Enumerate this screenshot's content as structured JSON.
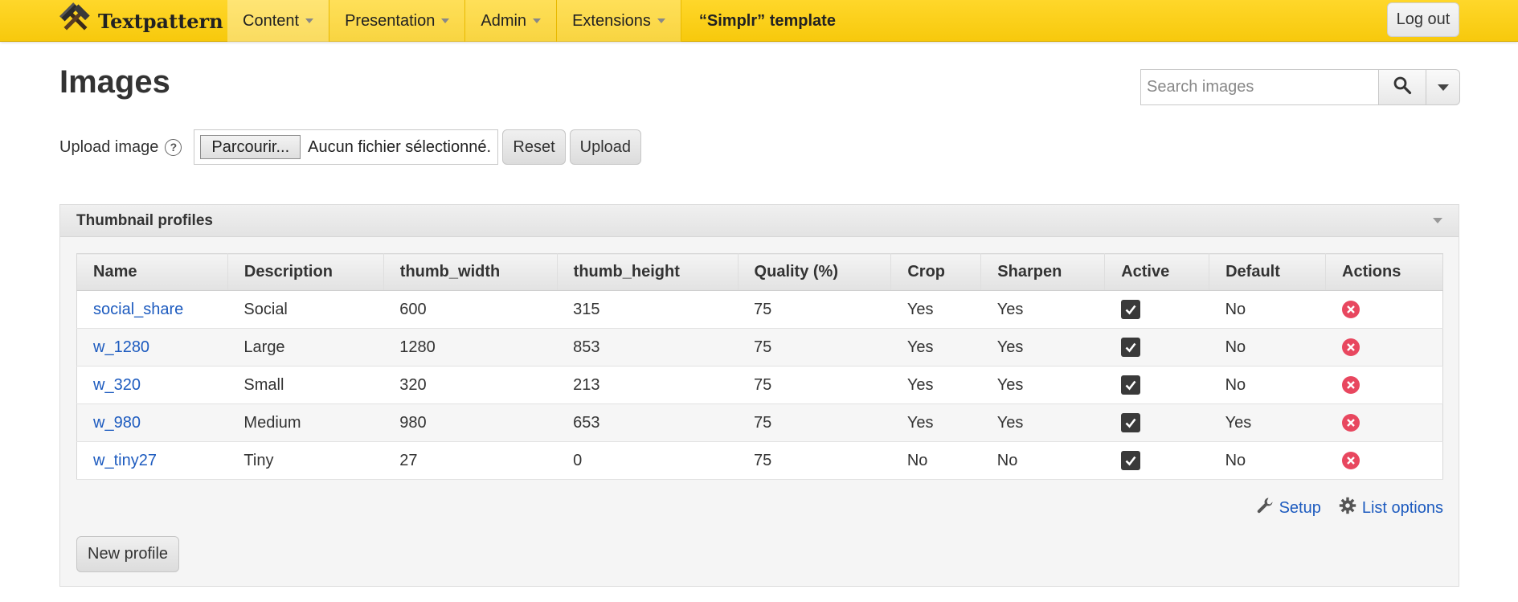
{
  "app": {
    "brand": "Textpattern",
    "site_name": "“Simplr” template",
    "logout_label": "Log out"
  },
  "nav": [
    {
      "label": "Content",
      "key": "content"
    },
    {
      "label": "Presentation",
      "key": "presentation"
    },
    {
      "label": "Admin",
      "key": "admin"
    },
    {
      "label": "Extensions",
      "key": "extensions"
    }
  ],
  "page": {
    "title": "Images"
  },
  "search": {
    "placeholder": "Search images"
  },
  "upload": {
    "label": "Upload image",
    "browse_label": "Parcourir...",
    "file_status": "Aucun fichier sélectionné.",
    "reset_label": "Reset",
    "upload_label": "Upload"
  },
  "panel": {
    "title": "Thumbnail profiles",
    "setup_label": "Setup",
    "list_options_label": "List options",
    "new_profile_label": "New profile"
  },
  "table": {
    "headers": [
      "Name",
      "Description",
      "thumb_width",
      "thumb_height",
      "Quality (%)",
      "Crop",
      "Sharpen",
      "Active",
      "Default",
      "Actions"
    ],
    "rows": [
      {
        "name": "social_share",
        "description": "Social",
        "width": "600",
        "height": "315",
        "quality": "75",
        "crop": "Yes",
        "sharpen": "Yes",
        "active": true,
        "default": "No"
      },
      {
        "name": "w_1280",
        "description": "Large",
        "width": "1280",
        "height": "853",
        "quality": "75",
        "crop": "Yes",
        "sharpen": "Yes",
        "active": true,
        "default": "No"
      },
      {
        "name": "w_320",
        "description": "Small",
        "width": "320",
        "height": "213",
        "quality": "75",
        "crop": "Yes",
        "sharpen": "Yes",
        "active": true,
        "default": "No"
      },
      {
        "name": "w_980",
        "description": "Medium",
        "width": "980",
        "height": "653",
        "quality": "75",
        "crop": "Yes",
        "sharpen": "Yes",
        "active": true,
        "default": "Yes"
      },
      {
        "name": "w_tiny27",
        "description": "Tiny",
        "width": "27",
        "height": "0",
        "quality": "75",
        "crop": "No",
        "sharpen": "No",
        "active": true,
        "default": "No"
      }
    ]
  },
  "colors": {
    "topbar": "#f7c90c",
    "link": "#1d5bbf",
    "delete": "#e8475f"
  },
  "icons": {
    "brand": "hammer-icon",
    "search": "search-icon",
    "help": "help-icon",
    "setup": "wrench-icon",
    "list_options": "gear-icon",
    "active": "checkbox-checked-icon",
    "delete": "delete-icon"
  }
}
